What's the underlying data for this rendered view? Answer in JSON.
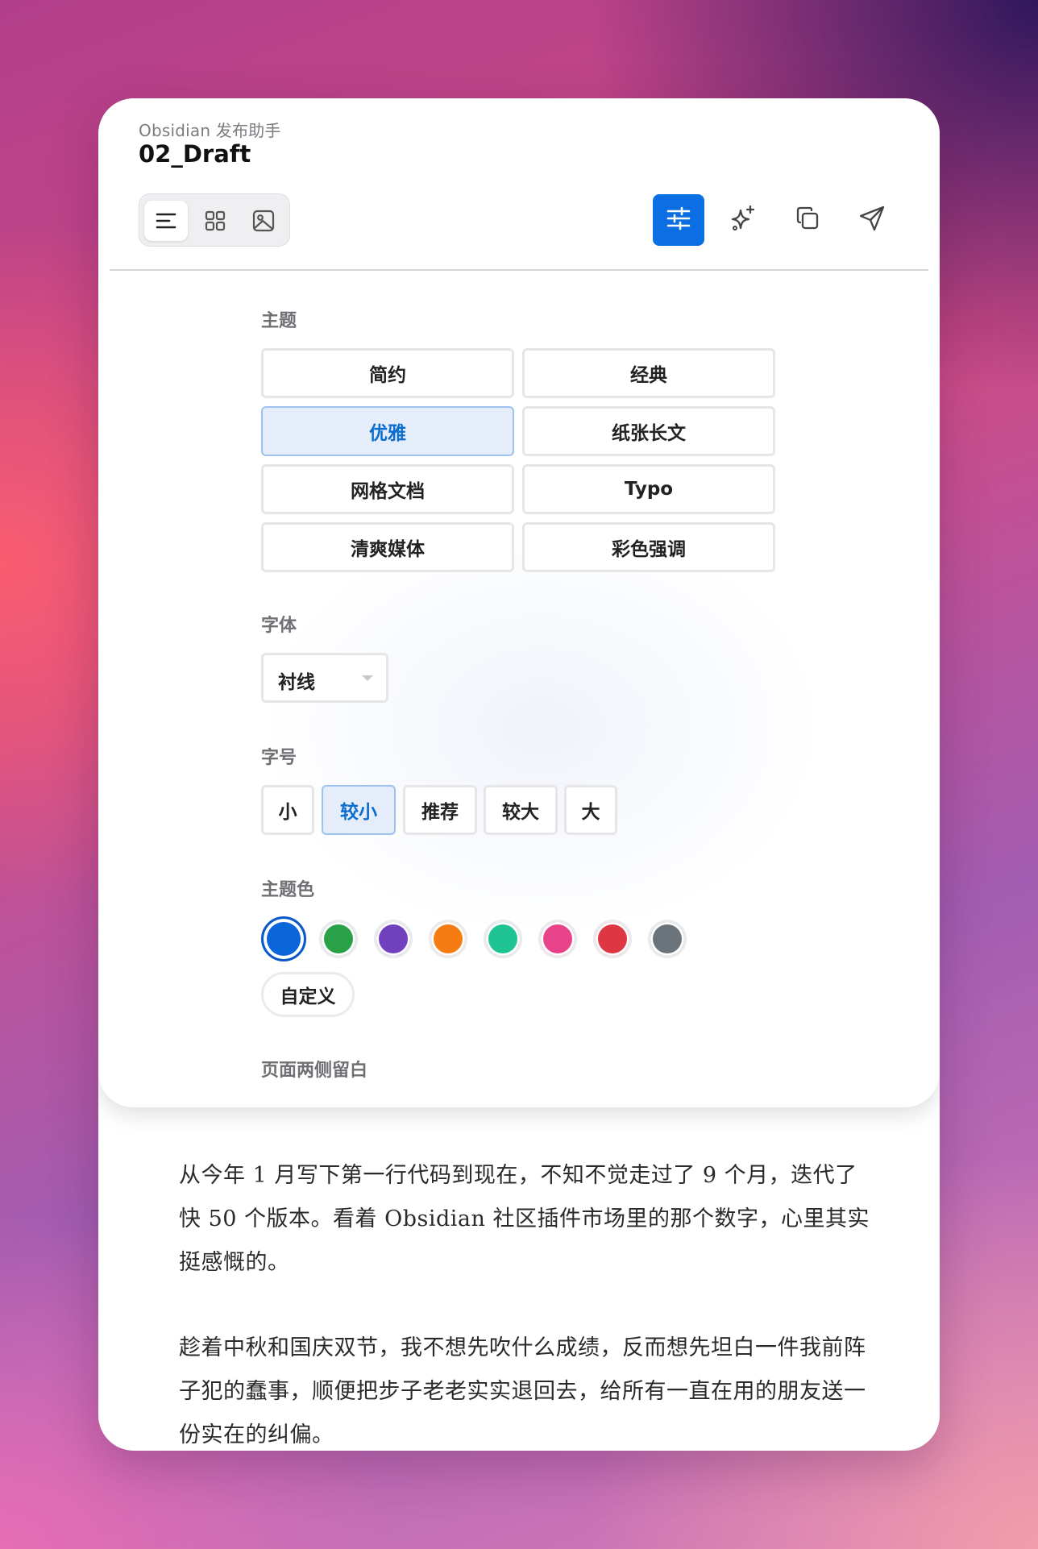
{
  "header": {
    "app_name": "Obsidian 发布助手",
    "doc_title": "02_Draft"
  },
  "view_switch": {
    "items": [
      {
        "icon": "list-icon",
        "active": true
      },
      {
        "icon": "grid-icon",
        "active": false
      },
      {
        "icon": "image-icon",
        "active": false
      }
    ]
  },
  "toolbar": {
    "items": [
      {
        "icon": "sliders-icon",
        "active": true
      },
      {
        "icon": "sparkles-icon",
        "active": false
      },
      {
        "icon": "copy-icon",
        "active": false
      },
      {
        "icon": "send-icon",
        "active": false
      }
    ]
  },
  "colors": {
    "accent": "#0b6ee2",
    "selected_bg": "#e4edf9",
    "selected_text": "#0b6ecf"
  },
  "settings": {
    "theme": {
      "label": "主题",
      "options": [
        "简约",
        "经典",
        "优雅",
        "纸张长文",
        "网格文档",
        "Typo",
        "清爽媒体",
        "彩色强调"
      ],
      "selected": "优雅"
    },
    "font": {
      "label": "字体",
      "value": "衬线"
    },
    "font_size": {
      "label": "字号",
      "options": [
        "小",
        "较小",
        "推荐",
        "较大",
        "大"
      ],
      "selected": "较小"
    },
    "theme_color": {
      "label": "主题色",
      "swatches": [
        "#0a66d8",
        "#2aa147",
        "#7040bf",
        "#f57c12",
        "#1fc492",
        "#e8438a",
        "#df3643",
        "#6b737b"
      ],
      "selected_index": 0,
      "custom_label": "自定义"
    },
    "margin": {
      "label": "页面两侧留白"
    }
  },
  "content": {
    "paragraphs": [
      "从今年 1 月写下第一行代码到现在，不知不觉走过了 9 个月，迭代了快 50 个版本。看着 Obsidian 社区插件市场里的那个数字，心里其实挺感慨的。",
      "趁着中秋和国庆双节，我不想先吹什么成绩，反而想先坦白一件我前阵子犯的蠢事，顺便把步子老老实实退回去，给所有一直在用的朋友送一份实在的纠偏。"
    ]
  }
}
